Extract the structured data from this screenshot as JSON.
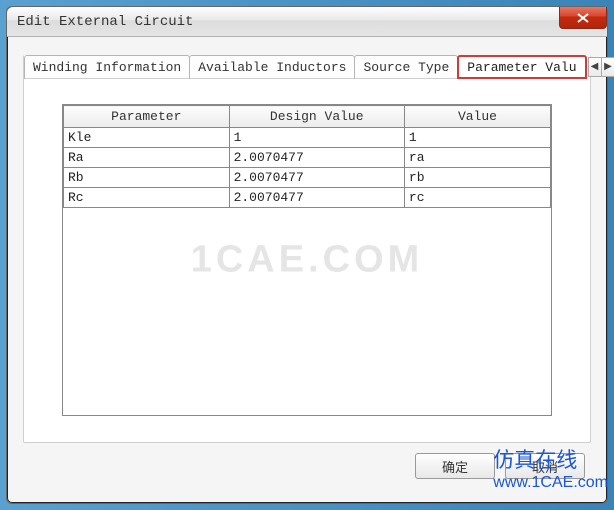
{
  "window": {
    "title": "Edit External Circuit"
  },
  "tabs": {
    "items": [
      {
        "label": "Winding Information"
      },
      {
        "label": "Available Inductors"
      },
      {
        "label": "Source Type"
      },
      {
        "label": "Parameter Valu"
      }
    ],
    "active_index": 3
  },
  "table": {
    "headers": [
      "Parameter",
      "Design Value",
      "Value"
    ],
    "rows": [
      {
        "param": "Kle",
        "design": "1",
        "value": "1"
      },
      {
        "param": "Ra",
        "design": "2.0070477",
        "value": "ra"
      },
      {
        "param": "Rb",
        "design": "2.0070477",
        "value": "rb"
      },
      {
        "param": "Rc",
        "design": "2.0070477",
        "value": "rc"
      }
    ]
  },
  "buttons": {
    "ok": "确定",
    "cancel": "取消"
  },
  "watermark": {
    "center": "1CAE.COM",
    "brand": "仿真在线",
    "url": "www.1CAE.com"
  },
  "scroll": {
    "left": "◀",
    "right": "▶"
  }
}
